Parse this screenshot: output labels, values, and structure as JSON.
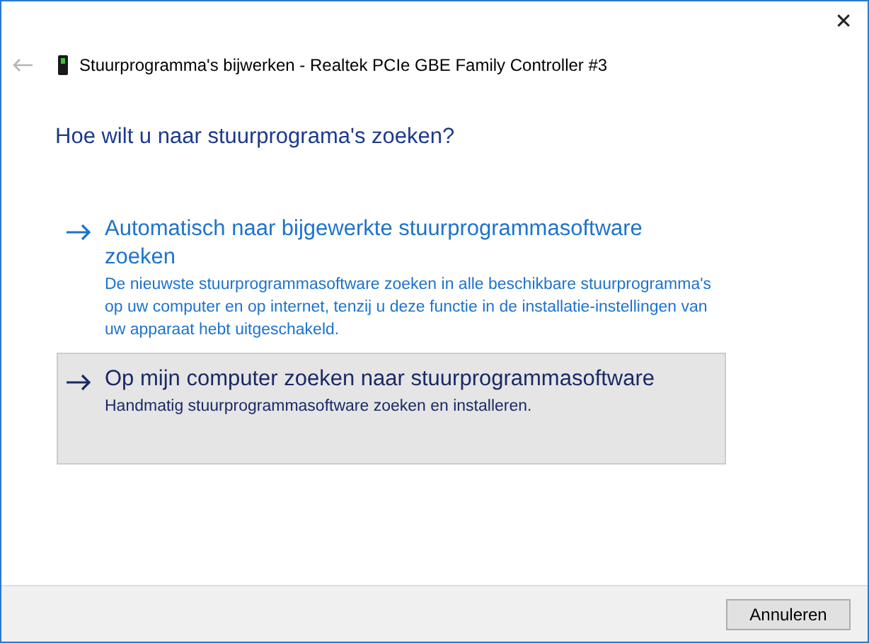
{
  "window": {
    "close_glyph": "✕"
  },
  "header": {
    "title": "Stuurprogramma's bijwerken - Realtek PCIe GBE Family Controller #3"
  },
  "question": "Hoe wilt u naar stuurprograma's zoeken?",
  "options": [
    {
      "title": "Automatisch naar bijgewerkte stuurprogrammasoftware zoeken",
      "description": " De nieuwste stuurprogrammasoftware zoeken in alle beschikbare stuurprogramma's op uw computer en op internet, tenzij u deze functie in de installatie-instellingen van uw apparaat hebt uitgeschakeld.",
      "selected": false
    },
    {
      "title": "Op mijn computer zoeken naar stuurprogrammasoftware",
      "description": "Handmatig stuurprogrammasoftware zoeken en installeren.",
      "selected": true
    }
  ],
  "buttons": [
    "Annuleren"
  ]
}
